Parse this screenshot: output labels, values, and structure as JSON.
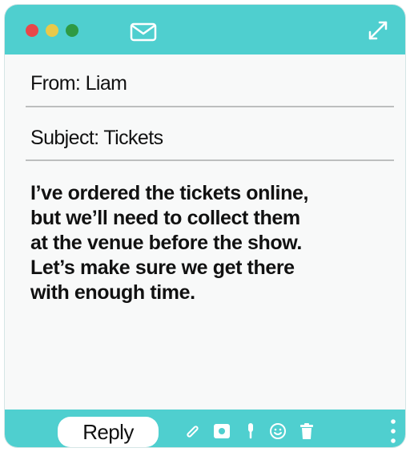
{
  "colors": {
    "accent": "#4fcfcf",
    "window_bg": "#f8f9f9",
    "traffic_red": "#e8474a",
    "traffic_yellow": "#e9c94a",
    "traffic_green": "#2e9a44"
  },
  "titlebar": {
    "icons": [
      "close-dot",
      "minimize-dot",
      "zoom-dot",
      "envelope-icon",
      "expand-icon"
    ]
  },
  "message": {
    "from": "From: Liam",
    "subject": "Subject: Tickets",
    "body": "I’ve ordered the tickets online,\nbut we’ll need to collect them\nat the venue before the show.\nLet’s make sure we get there\nwith enough time."
  },
  "toolbar": {
    "reply_label": "Reply",
    "icons": [
      "paperclip-icon",
      "photo-icon",
      "microphone-icon",
      "emoji-icon",
      "trash-icon",
      "more-vertical-icon"
    ]
  }
}
